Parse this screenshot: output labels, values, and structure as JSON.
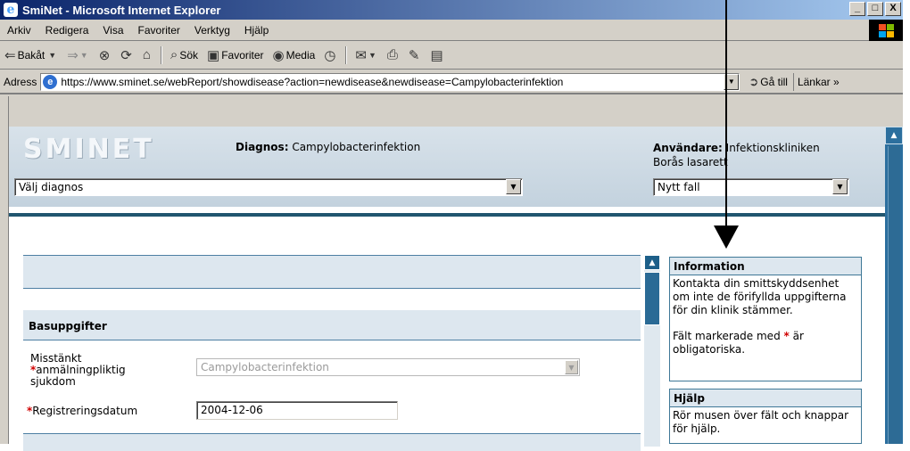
{
  "window": {
    "title": "SmiNet - Microsoft Internet Explorer",
    "controls": {
      "minimize": "_",
      "maximize": "□",
      "close": "X"
    }
  },
  "menu": [
    "Arkiv",
    "Redigera",
    "Visa",
    "Favoriter",
    "Verktyg",
    "Hjälp"
  ],
  "toolbar": {
    "back": "Bakåt",
    "search": "Sök",
    "favorites": "Favoriter",
    "media": "Media"
  },
  "address": {
    "label": "Adress",
    "url": "https://www.sminet.se/webReport/showdisease?action=newdisease&newdisease=Campylobacterinfektion",
    "go": "Gå till",
    "links": "Länkar"
  },
  "app": {
    "logo": "SMINET",
    "diagnosis_label": "Diagnos:",
    "diagnosis_value": "Campylobacterinfektion",
    "user_label": "Användare:",
    "user_value": "Infektionskliniken",
    "user_location": "Borås lasarett",
    "diagnosis_select": "Välj diagnos",
    "case_select": "Nytt fall"
  },
  "form": {
    "section_title": "Basuppgifter",
    "suspected_label_1": "Misstänkt",
    "suspected_label_2": "anmälningpliktig",
    "suspected_label_3": "sjukdom",
    "suspected_value": "Campylobacterinfektion",
    "regdate_label": "Registreringsdatum",
    "regdate_value": "2004-12-06",
    "required_mark": "*"
  },
  "info": {
    "title": "Information",
    "text_1": "Kontakta din smittskyddsenhet om inte de förifyllda uppgifterna för din klinik stämmer.",
    "text_2a": "Fält markerade med",
    "text_2b": "är obligatoriska.",
    "help_title": "Hjälp",
    "help_text": "Rör musen över fält och knappar för hjälp."
  },
  "colors": {
    "accent": "#21566f",
    "band": "#dde7ef",
    "required": "#d00000"
  }
}
